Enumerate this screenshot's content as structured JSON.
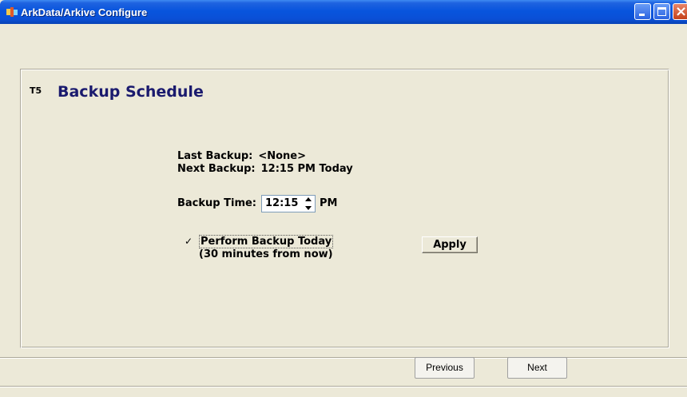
{
  "window": {
    "title": "ArkData/Arkive Configure"
  },
  "header": {
    "step": "T5",
    "title": "Backup Schedule"
  },
  "info": {
    "last_label": "Last Backup:",
    "last_value": "<None>",
    "next_label": "Next Backup:",
    "next_value": "12:15 PM Today"
  },
  "backup_time": {
    "label": "Backup Time:",
    "value": "12:15",
    "ampm": "PM"
  },
  "perform": {
    "checked": true,
    "check_glyph": "✓",
    "label": "Perform Backup Today",
    "sub": "(30 minutes from now)"
  },
  "buttons": {
    "apply": "Apply",
    "previous": "Previous",
    "next": "Next"
  },
  "icons": {
    "app": "app-icon",
    "minimize": "minimize-icon",
    "maximize": "maximize-icon",
    "close": "close-icon"
  }
}
